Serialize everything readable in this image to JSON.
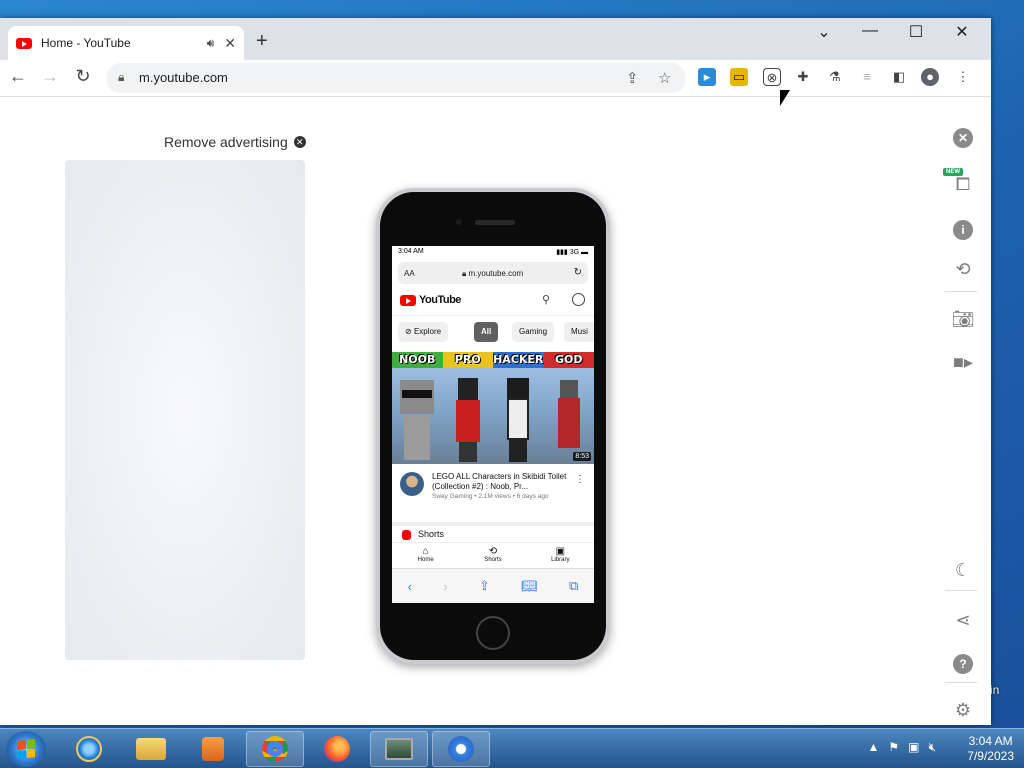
{
  "browser": {
    "tab_title": "Home - YouTube",
    "url": "m.youtube.com",
    "new_tab": "+",
    "window_controls": {
      "dropdown": "⌄",
      "minimize": "—",
      "maximize": "☐",
      "close": "✕"
    }
  },
  "page": {
    "remove_ad_label": "Remove advertising"
  },
  "phone": {
    "status_time": "3:04 AM",
    "status_signal": "3G",
    "safari_aa": "AA",
    "safari_url": "m.youtube.com",
    "logo_text": "YouTube",
    "chips": [
      "Explore",
      "All",
      "Gaming",
      "Musi"
    ],
    "thumb_labels": [
      "NOOB",
      "PRO",
      "HACKER",
      "GOD"
    ],
    "video_duration": "8:53",
    "video_title": "LEGO ALL Characters in Skibidi Toilet (Collection #2) : Noob, Pr...",
    "video_subtitle": "Sway Gaming • 2.1M views • 6 days ago",
    "shorts_label": "Shorts",
    "bottom_nav": [
      "Home",
      "Shorts",
      "Library"
    ]
  },
  "side_panel": {
    "new_badge": "NEW"
  },
  "desktop": {
    "partial_label": "in"
  },
  "taskbar": {
    "time": "3:04 AM",
    "date": "7/9/2023"
  },
  "colors": {
    "youtube_red": "#ff0000",
    "taskbar": "#24548c",
    "safari_blue": "#2f7cf6"
  }
}
